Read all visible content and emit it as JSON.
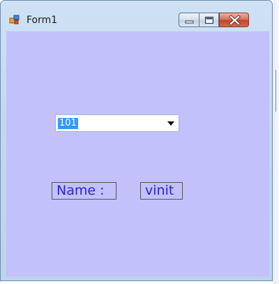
{
  "window": {
    "title": "Form1",
    "icon": "winforms-app-icon",
    "caption_buttons": [
      "minimize-icon",
      "maximize-icon",
      "close-icon"
    ]
  },
  "form": {
    "background_color": "#c2c1fb",
    "combo": {
      "selected_value": "101"
    },
    "name_label": "Name :",
    "name_value": "vinit",
    "label_text_color": "#2b23d6"
  }
}
